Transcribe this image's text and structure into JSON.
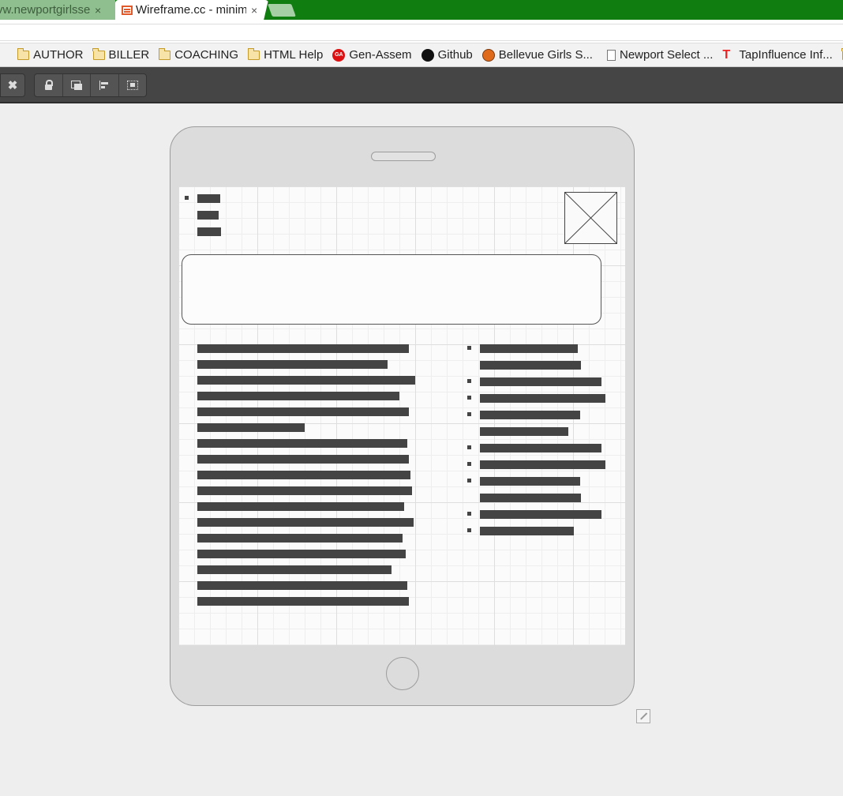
{
  "browser": {
    "tabs": [
      {
        "title": "vw.newportgirlsselect",
        "active": false,
        "close": "×"
      },
      {
        "title": "Wireframe.cc - minimal wireframing tool",
        "active": true,
        "close": "×"
      }
    ],
    "bookmarks": [
      {
        "label": "",
        "icon": "folder-icon"
      },
      {
        "label": "AUTHOR",
        "icon": "folder-icon"
      },
      {
        "label": "BILLER",
        "icon": "folder-icon"
      },
      {
        "label": "COACHING",
        "icon": "folder-icon"
      },
      {
        "label": "HTML Help",
        "icon": "folder-icon"
      },
      {
        "label": "Gen-Assem",
        "icon": "gen-assem-icon"
      },
      {
        "label": "Github",
        "icon": "github-icon"
      },
      {
        "label": "Bellevue Girls S...",
        "icon": "basketball-icon"
      },
      {
        "label": "Newport Select ...",
        "icon": "page-icon"
      },
      {
        "label": "TapInfluence Inf...",
        "icon": "tapinfluence-icon"
      },
      {
        "label": "",
        "icon": "folder-icon"
      }
    ]
  },
  "toolbar": {
    "close": "✖",
    "tools": [
      {
        "name": "lock-icon"
      },
      {
        "name": "bring-to-front-icon"
      },
      {
        "name": "align-icon"
      },
      {
        "name": "group-icon"
      }
    ]
  },
  "wireframe": {
    "device": "tablet",
    "image_placeholder": "image-placeholder-icon"
  },
  "colors": {
    "tab_strip": "#107d10",
    "toolbar": "#454545",
    "canvas": "#eeeeee",
    "device": "#dcdcdc",
    "placeholder_bar": "#444444"
  }
}
